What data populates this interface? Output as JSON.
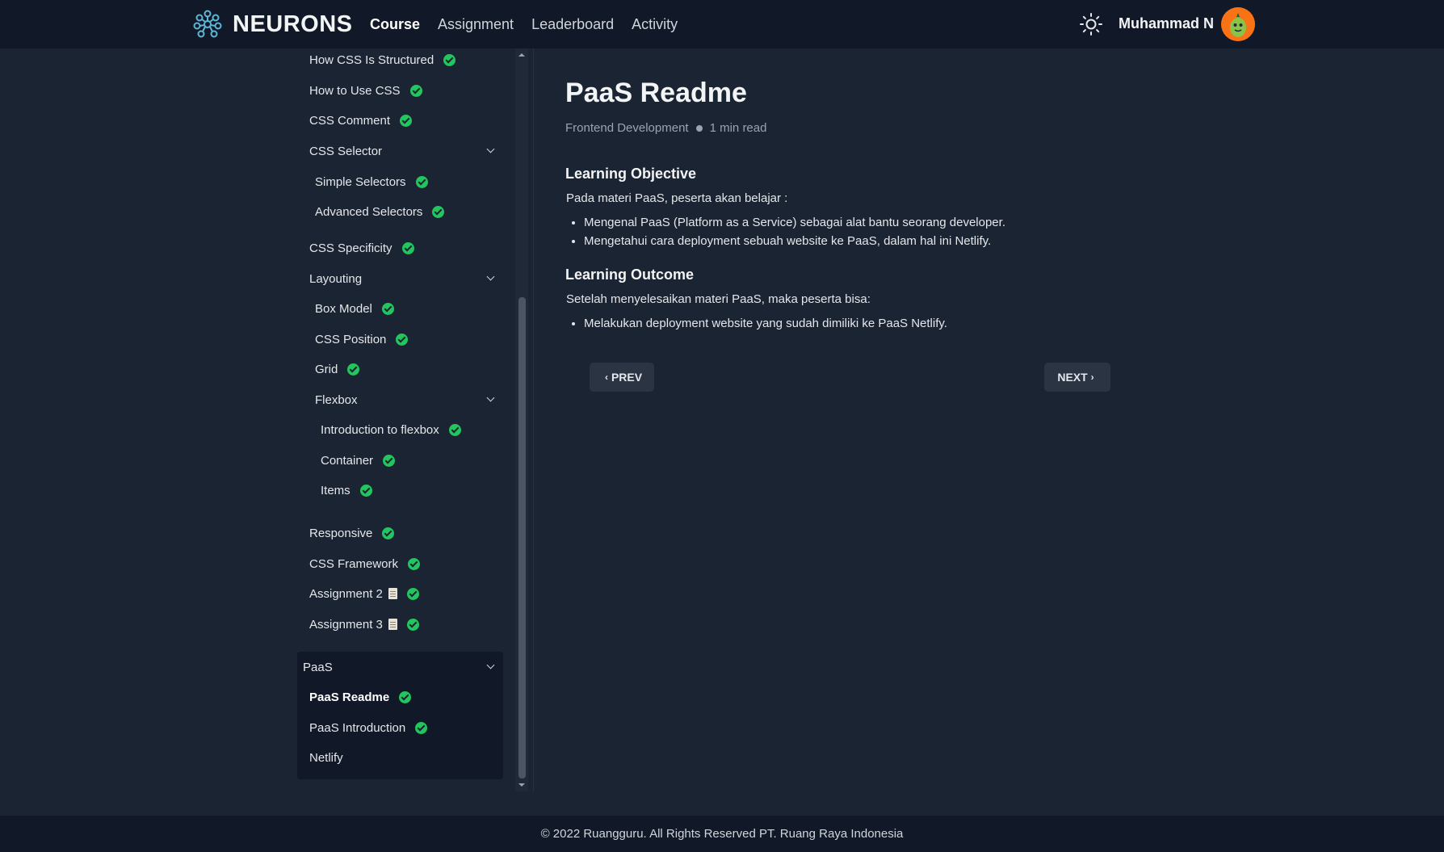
{
  "header": {
    "brand": "NEURONS",
    "nav": [
      "Course",
      "Assignment",
      "Leaderboard",
      "Activity"
    ],
    "active_nav": "Course",
    "user_name": "Muhammad N",
    "icons": {
      "logo": "neurons-logo-icon",
      "theme": "sun-icon",
      "avatar": "avatar"
    },
    "colors": {
      "bg": "#111827",
      "accent": "#22c55e"
    }
  },
  "sidebar": {
    "items": [
      {
        "label": "How CSS Is Structured",
        "done": true
      },
      {
        "label": "How to Use CSS",
        "done": true
      },
      {
        "label": "CSS Comment",
        "done": true
      },
      {
        "label": "CSS Selector",
        "expandable": true
      },
      {
        "label": "Simple Selectors",
        "done": true
      },
      {
        "label": "Advanced Selectors",
        "done": true
      },
      {
        "label": "CSS Specificity",
        "done": true
      },
      {
        "label": "Layouting",
        "expandable": true
      },
      {
        "label": "Box Model",
        "done": true
      },
      {
        "label": "CSS Position",
        "done": true
      },
      {
        "label": "Grid",
        "done": true
      },
      {
        "label": "Flexbox",
        "expandable": true
      },
      {
        "label": "Introduction to flexbox",
        "done": true
      },
      {
        "label": "Container",
        "done": true
      },
      {
        "label": "Items",
        "done": true
      },
      {
        "label": "Responsive",
        "done": true
      },
      {
        "label": "CSS Framework",
        "done": true
      },
      {
        "label": "Assignment 2",
        "done": true,
        "doc": true
      },
      {
        "label": "Assignment 3",
        "done": true,
        "doc": true
      },
      {
        "label": "PaaS",
        "expandable": true
      },
      {
        "label": "PaaS Readme",
        "done": true,
        "current": true
      },
      {
        "label": "PaaS Introduction",
        "done": true
      },
      {
        "label": "Netlify",
        "done": false
      }
    ]
  },
  "main": {
    "title": "PaaS Readme",
    "category": "Frontend Development",
    "read_time": "1 min read",
    "objective_heading": "Learning Objective",
    "objective_intro": "Pada materi PaaS, peserta akan belajar :",
    "objective_points": [
      "Mengenal PaaS (Platform as a Service) sebagai alat bantu seorang developer.",
      "Mengetahui cara deployment sebuah website ke PaaS, dalam hal ini Netlify."
    ],
    "outcome_heading": "Learning Outcome",
    "outcome_intro": "Setelah menyelesaikan materi PaaS, maka peserta bisa:",
    "outcome_points": [
      "Melakukan deployment website yang sudah dimiliki ke PaaS Netlify."
    ],
    "prev_label": "PREV",
    "next_label": "NEXT"
  },
  "footer": {
    "text": "© 2022 Ruangguru. All Rights Reserved PT. Ruang Raya Indonesia"
  }
}
